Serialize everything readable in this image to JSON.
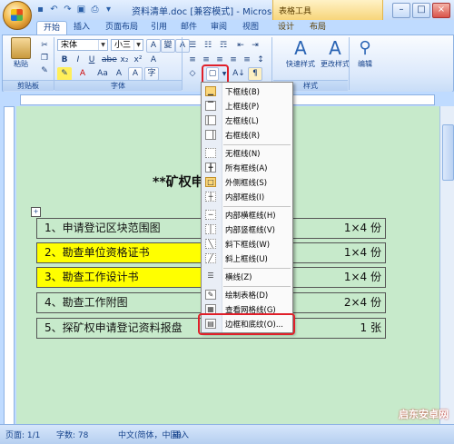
{
  "window": {
    "doc_title": "资料清单.doc [兼容模式] - Microsoft ...",
    "context_title": "表格工具",
    "min": "–",
    "max": "□",
    "close": "×"
  },
  "tabs": [
    "开始",
    "插入",
    "页面布局",
    "引用",
    "邮件",
    "审阅",
    "视图",
    "设计",
    "布局"
  ],
  "ribbon": {
    "font_name": "宋体",
    "font_size": "小三",
    "groups": {
      "clipboard": "剪贴板",
      "font": "字体",
      "styles": "样式"
    },
    "paste_label": "粘贴",
    "quick_styles": "快速样式",
    "change_styles": "更改样式",
    "editing": "编辑"
  },
  "document": {
    "heading": "**矿权申",
    "rows": [
      {
        "text": "1、申请登记区块范围图",
        "right": "1×4 份",
        "highlight": false
      },
      {
        "text": "2、勘查单位资格证书",
        "right": "1×4 份",
        "highlight": true
      },
      {
        "text": "3、勘查工作设计书",
        "right": "1×4 份",
        "highlight": true
      },
      {
        "text": "4、勘查工作附图",
        "right": "2×4 份",
        "highlight": false
      },
      {
        "text": "5、探矿权申请登记资料报盘",
        "right": "1 张",
        "highlight": false
      }
    ]
  },
  "menu": {
    "items": [
      {
        "label": "下框线(B)",
        "icon": "bottom-border-icon",
        "highlight": true
      },
      {
        "label": "上框线(P)",
        "icon": "top-border-icon",
        "highlight": false
      },
      {
        "label": "左框线(L)",
        "icon": "left-border-icon",
        "highlight": false
      },
      {
        "label": "右框线(R)",
        "icon": "right-border-icon",
        "highlight": false
      },
      {
        "label": "无框线(N)",
        "icon": "no-border-icon",
        "highlight": false
      },
      {
        "label": "所有框线(A)",
        "icon": "all-borders-icon",
        "highlight": false
      },
      {
        "label": "外侧框线(S)",
        "icon": "outside-borders-icon",
        "highlight": true
      },
      {
        "label": "内部框线(I)",
        "icon": "inside-borders-icon",
        "highlight": false
      },
      {
        "label": "内部横框线(H)",
        "icon": "inside-horizontal-border-icon",
        "highlight": false
      },
      {
        "label": "内部竖框线(V)",
        "icon": "inside-vertical-border-icon",
        "highlight": false
      },
      {
        "label": "斜下框线(W)",
        "icon": "diagonal-down-border-icon",
        "highlight": false
      },
      {
        "label": "斜上框线(U)",
        "icon": "diagonal-up-border-icon",
        "highlight": false
      },
      {
        "label": "横线(Z)",
        "icon": "horizontal-line-icon",
        "highlight": false
      },
      {
        "label": "绘制表格(D)",
        "icon": "draw-table-icon",
        "highlight": false
      },
      {
        "label": "查看网格线(G)",
        "icon": "view-gridlines-icon",
        "highlight": false
      },
      {
        "label": "边框和底纹(O)...",
        "icon": "borders-and-shading-icon",
        "highlight": false
      }
    ]
  },
  "status": {
    "page": "页面: 1/1",
    "words": "字数: 78",
    "language": "中文(简体，中国)",
    "mode": "插入"
  },
  "watermark": "启东安卓网"
}
